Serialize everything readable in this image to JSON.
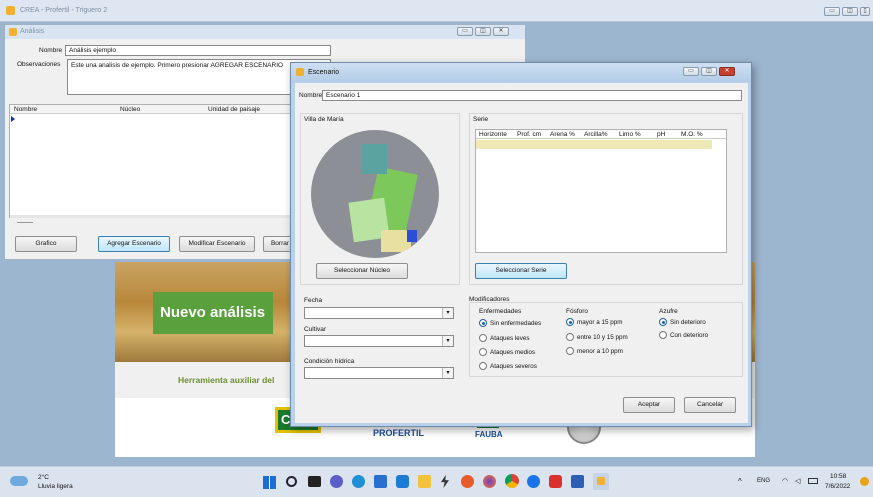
{
  "app": {
    "title": "CREA - Profertil - Triguero 2"
  },
  "analisis_window": {
    "title": "Análisis",
    "nombre_label": "Nombre",
    "nombre_value": "Análisis ejemplo",
    "observaciones_label": "Observaciones",
    "observaciones_value": "Este una analisis de ejemplo. Primero presionar AGREGAR ESCENARIO",
    "grid_columns": [
      "Nombre",
      "Núcleo",
      "Unidad de paisaje"
    ],
    "buttons": {
      "grafico": "Grafico",
      "agregar": "Agregar Escenario",
      "modificar": "Modificar Escenario",
      "borrar": "Borrar"
    }
  },
  "background": {
    "banner_text": "Nuevo análisis",
    "tagline": "Herramienta auxiliar del",
    "logos": [
      "CREA",
      "PROFERTIL",
      "FAUBA"
    ]
  },
  "escenario_dialog": {
    "title": "Escenario",
    "nombre_label": "Nombre",
    "nombre_value": "Escenario 1",
    "region_label": "Villa de María",
    "serie_label": "Serie",
    "serie_columns": [
      "Horizonte",
      "Prof. cm",
      "Arena %",
      "Arcilla%",
      "Limo %",
      "pH",
      "M.O. %"
    ],
    "btn_nucleo": "Seleccionar Núcleo",
    "btn_serie": "Seleccionar Serie",
    "fecha_label": "Fecha",
    "cultivar_label": "Cultivar",
    "condicion_label": "Condición hídrica",
    "modificadores_label": "Modificadores",
    "enfermedades": {
      "label": "Enfermedades",
      "options": [
        "Sin enfermedades",
        "Ataques leves",
        "Ataques medios",
        "Ataques severos"
      ]
    },
    "fosforo": {
      "label": "Fósforo",
      "options": [
        "mayor a 15 ppm",
        "entre 10 y 15 ppm",
        "menor a 10 ppm"
      ]
    },
    "azufre": {
      "label": "Azufre",
      "options": [
        "Sin deterioro",
        "Con deterioro"
      ]
    },
    "btn_aceptar": "Aceptar",
    "btn_cancelar": "Cancelar"
  },
  "taskbar": {
    "weather_temp": "2°C",
    "weather_desc": "Lluvia ligera",
    "lang": "ENG",
    "time": "10:58",
    "date": "7/6/2022"
  }
}
